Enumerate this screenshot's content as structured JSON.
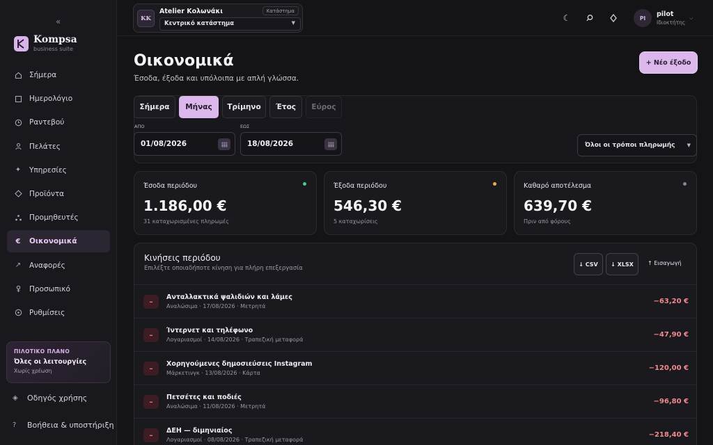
{
  "sidebar": {
    "collapse_glyph": "«",
    "brand_letter": "K",
    "brand_name": "Kompsa",
    "brand_sub": "business suite",
    "items": [
      {
        "label": "Σήμερα",
        "icon": "home-icon"
      },
      {
        "label": "Ημερολόγιο",
        "icon": "calendar-icon"
      },
      {
        "label": "Ραντεβού",
        "icon": "clock-icon"
      },
      {
        "label": "Πελάτες",
        "icon": "user-icon"
      },
      {
        "label": "Υπηρεσίες",
        "icon": "sparkle-icon"
      },
      {
        "label": "Προϊόντα",
        "icon": "diamond-icon"
      },
      {
        "label": "Προμηθευτές",
        "icon": "dots-icon"
      },
      {
        "label": "Οικονομικά",
        "icon": "euro-icon",
        "active": true
      },
      {
        "label": "Αναφορές",
        "icon": "trend-icon"
      },
      {
        "label": "Προσωπικό",
        "icon": "staff-icon"
      },
      {
        "label": "Ρυθμίσεις",
        "icon": "gear-icon"
      }
    ],
    "plan": {
      "kicker": "ΠΙΛΟΤΙΚΟ ΠΛΑΝΟ",
      "title": "Όλες οι λειτουργίες",
      "sub": "Χωρίς χρέωση"
    },
    "guide_label": "Οδηγός χρήσης",
    "help_label": "Βοήθεια & υποστήριξη"
  },
  "topbar": {
    "store_initials": "KK",
    "store_name": "Atelier Κολωνάκι",
    "store_badge": "Κατάστημα",
    "store_select": "Κεντρικό κατάστημα",
    "user_initials": "PI",
    "user_name": "pilot",
    "user_role": "Ιδιοκτήτης"
  },
  "main": {
    "title": "Οικονομικά",
    "subtitle": "Έσοδα, έξοδα και υπόλοιπα με απλή γλώσσα.",
    "new_button": "+ Νέο έξοδο",
    "tabs": [
      "Σήμερα",
      "Μήνας",
      "Τρίμηνο",
      "Έτος",
      "Εύρος"
    ],
    "from_label": "ΑΠΟ",
    "from_value": "01/08/2026",
    "to_label": "ΕΩΣ",
    "to_value": "18/08/2026",
    "payment_select": "Όλοι οι τρόποι πληρωμής",
    "cards": [
      {
        "label": "Έσοδα περιόδου",
        "value": "1.186,00 €",
        "note": "31 καταχωρισμένες πληρωμές",
        "dot": "#4fc98a"
      },
      {
        "label": "Έξοδα περιόδου",
        "value": "546,30 €",
        "note": "5 καταχωρίσεις",
        "dot": "#e7b24d"
      },
      {
        "label": "Καθαρό αποτέλεσμα",
        "value": "639,70 €",
        "note": "Πριν από φόρους",
        "dot": "#8a8690"
      }
    ],
    "moves": {
      "title": "Κινήσεις περιόδου",
      "subtitle": "Επιλέξτε οποιαδήποτε κίνηση για πλήρη επεξεργασία",
      "csv": "↓ CSV",
      "xlsx": "↓ XLSX",
      "import": "↑ Εισαγωγή",
      "badge": "–",
      "rows": [
        {
          "title": "Ανταλλακτικά ψαλιδιών και λάμες",
          "meta": "Αναλώσιμα · 17/08/2026 · Μετρητά",
          "amount": "−63,20 €"
        },
        {
          "title": "Ίντερνετ και τηλέφωνο",
          "meta": "Λογαριασμοί · 14/08/2026 · Τραπεζική μεταφορά",
          "amount": "−47,90 €"
        },
        {
          "title": "Χορηγούμενες δημοσιεύσεις Instagram",
          "meta": "Μάρκετινγκ · 13/08/2026 · Κάρτα",
          "amount": "−120,00 €"
        },
        {
          "title": "Πετσέτες και ποδιές",
          "meta": "Αναλώσιμα · 11/08/2026 · Μετρητά",
          "amount": "−96,80 €"
        },
        {
          "title": "ΔΕΗ — διμηνιαίος",
          "meta": "Λογαριασμοί · 08/08/2026 · Τραπεζική μεταφορά",
          "amount": "−218,40 €"
        }
      ]
    }
  }
}
